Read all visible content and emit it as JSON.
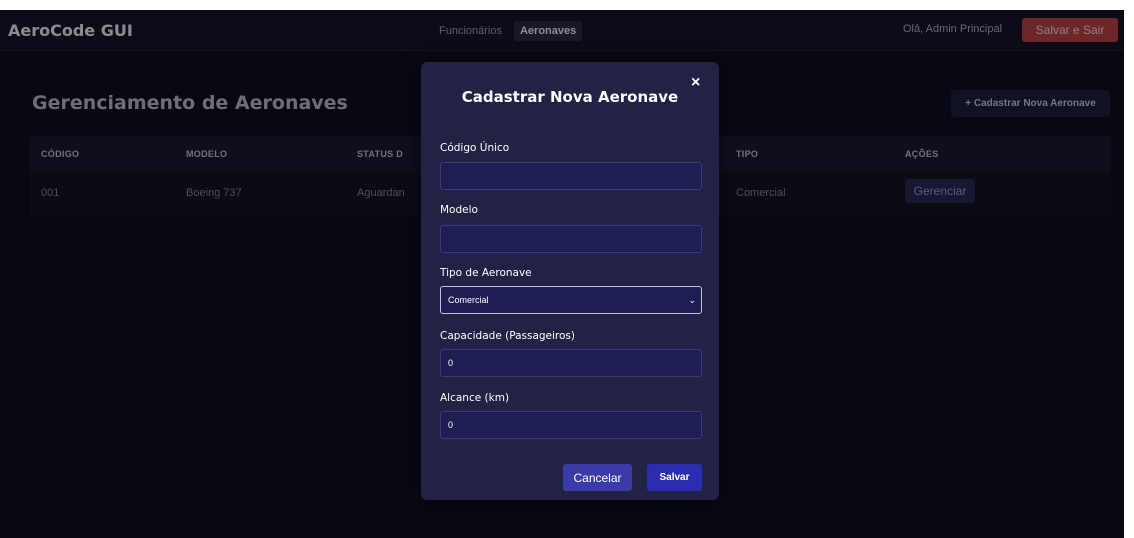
{
  "app": {
    "brand": "AeroCode GUI",
    "nav": [
      {
        "label": "Funcionários",
        "active": false
      },
      {
        "label": "Aeronaves",
        "active": true
      }
    ],
    "greeting": "Olá, Admin Principal",
    "exit_label": "Salvar e Sair"
  },
  "page": {
    "title": "Gerenciamento de Aeronaves",
    "new_button_label": "+ Cadastrar Nova Aeronave",
    "table": {
      "columns": [
        "CÓDIGO",
        "MODELO",
        "STATUS D",
        "TIPO",
        "AÇÕES"
      ],
      "rows": [
        {
          "codigo": "001",
          "modelo": "Boeing 737",
          "status": "Aguardan",
          "tipo": "Comercial",
          "action_label": "Gerenciar"
        }
      ]
    }
  },
  "modal": {
    "title": "Cadastrar Nova Aeronave",
    "close_glyph": "×",
    "fields": {
      "codigo": {
        "label": "Código Único",
        "value": ""
      },
      "modelo": {
        "label": "Modelo",
        "value": ""
      },
      "tipo": {
        "label": "Tipo de Aeronave",
        "selected": "Comercial"
      },
      "capacidade": {
        "label": "Capacidade (Passageiros)",
        "value": "0"
      },
      "alcance": {
        "label": "Alcance (km)",
        "value": "0"
      }
    },
    "cancel_label": "Cancelar",
    "save_label": "Salvar"
  },
  "icons": {
    "close": "close-icon",
    "select_caret": "chevron-down-icon"
  },
  "colors": {
    "background": "#0f0f22",
    "navbar": "#17172e",
    "exit_button": "#c9474c",
    "modal": "#222244",
    "primary_button": "#2c2cb0"
  }
}
